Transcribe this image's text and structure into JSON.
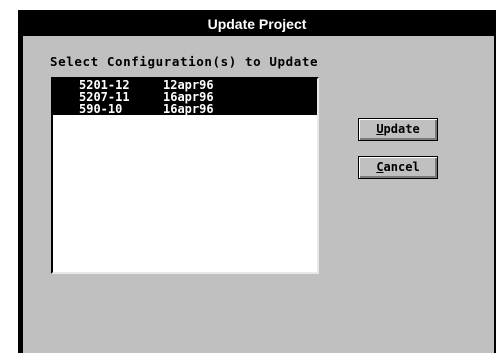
{
  "dialog": {
    "title": "Update Project",
    "prompt": "Select Configuration(s) to Update"
  },
  "list": {
    "items": [
      {
        "name": "5201-12",
        "date": "12apr96",
        "selected": true
      },
      {
        "name": "5207-11",
        "date": "16apr96",
        "selected": true
      },
      {
        "name": "590-10",
        "date": "16apr96",
        "selected": true
      }
    ]
  },
  "buttons": {
    "update": {
      "mnemonic": "U",
      "rest": "pdate"
    },
    "cancel": {
      "mnemonic": "C",
      "rest": "ancel"
    }
  }
}
